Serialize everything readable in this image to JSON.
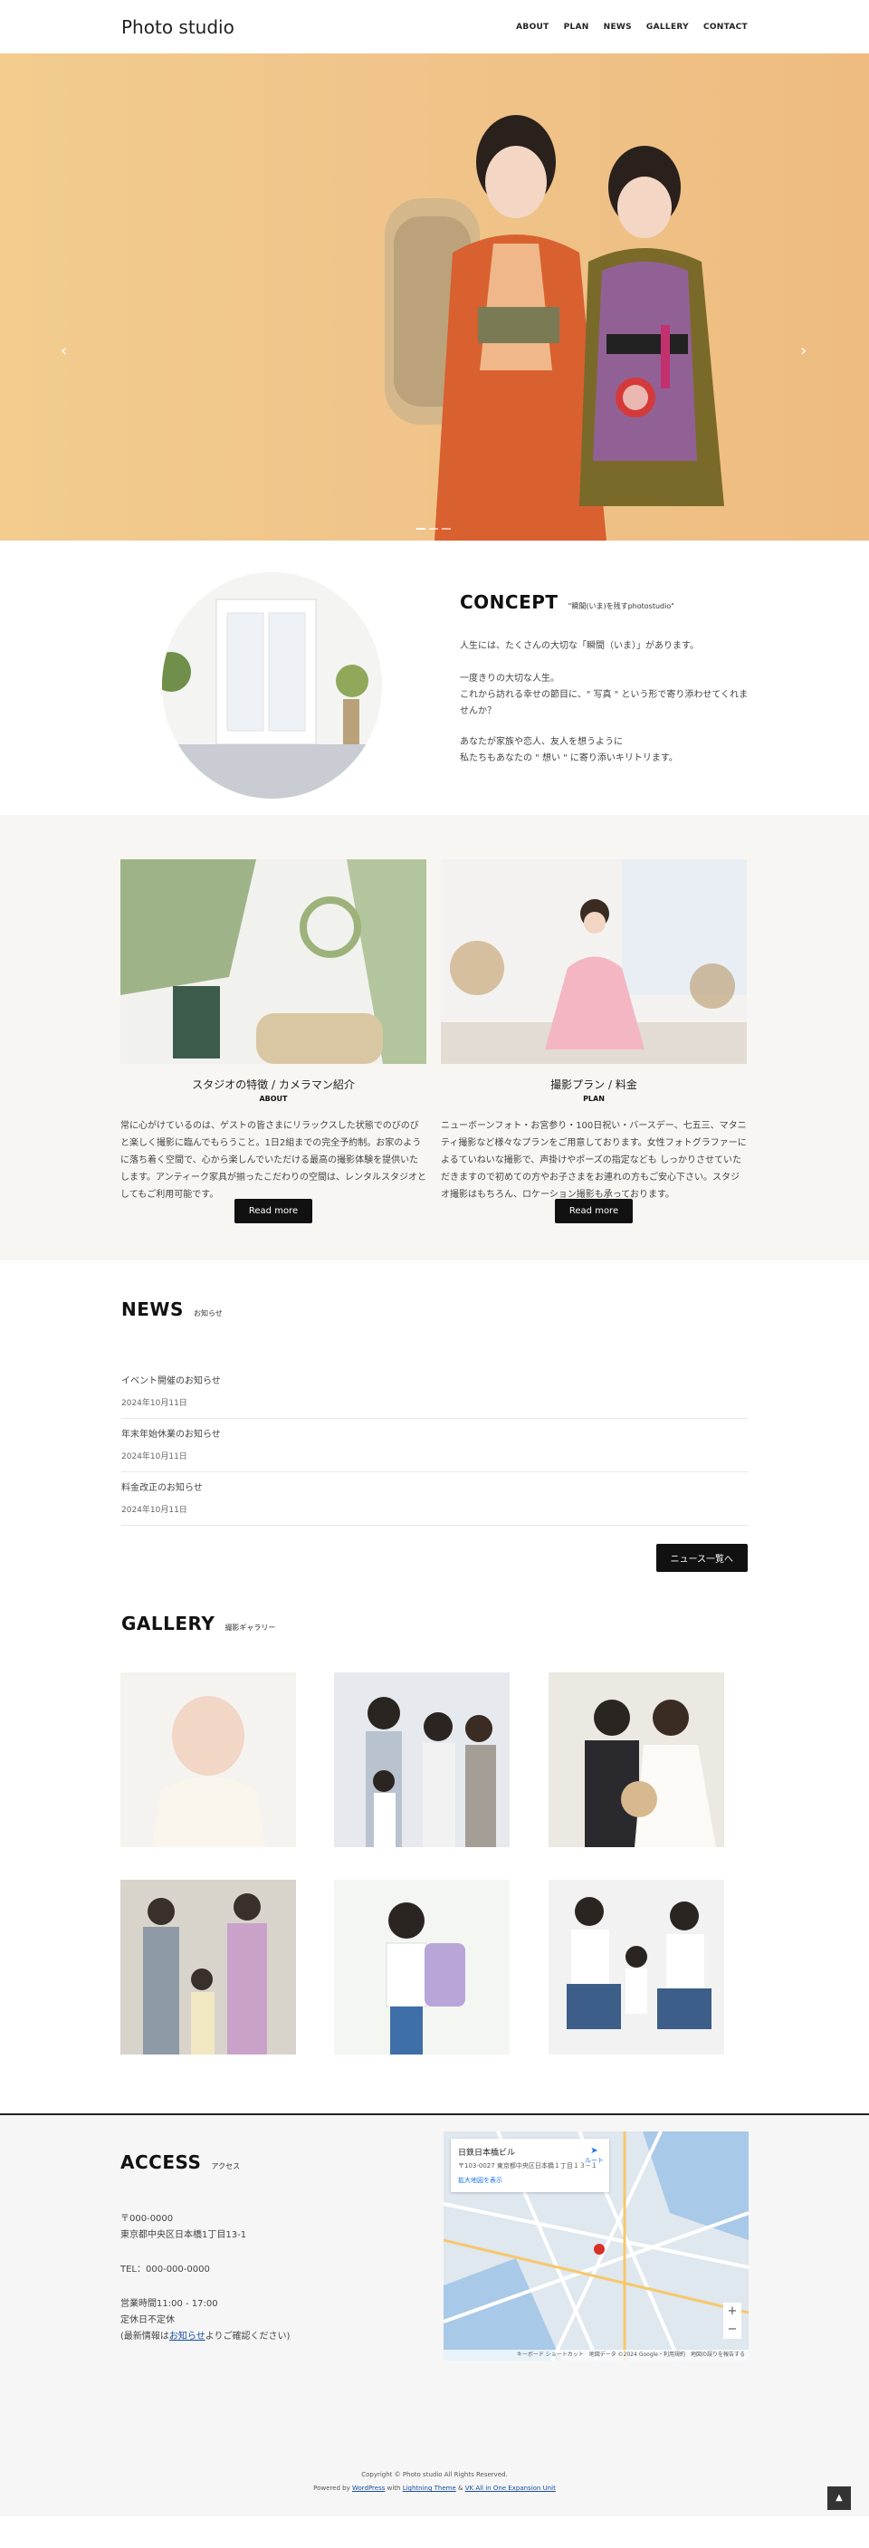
{
  "header": {
    "logo": "Photo studio",
    "nav": [
      "ABOUT",
      "PLAN",
      "NEWS",
      "GALLERY",
      "CONTACT"
    ]
  },
  "hero": {
    "prev_icon": "chevron-left-icon",
    "next_icon": "chevron-right-icon",
    "prev_glyph": "‹",
    "next_glyph": "›",
    "background_color": "#f0c58b"
  },
  "concept": {
    "title": "CONCEPT",
    "subtitle": "\"瞬間(いま)を残すphotostudio\"",
    "p1": "人生には、たくさんの大切な「瞬間（いま）」があります。",
    "p2": "一度きりの大切な人生。\nこれから訪れる幸せの節目に、\" 写真 \" という形で寄り添わせてくれませんか？",
    "p3": "あなたが家族や恋人、友人を想うように\n私たちもあなたの \" 想い \" に寄り添いキリトリます。"
  },
  "features": [
    {
      "title": "スタジオの特徴 / カメラマン紹介",
      "en": "ABOUT",
      "text": "常に心がけているのは、ゲストの皆さまにリラックスした状態でのびのびと楽しく撮影に臨んでもらうこと。1日2組までの完全予約制。お家のように落ち着く空間で、心から楽しんでいただける最高の撮影体験を提供いたします。アンティーク家具が揃ったこだわりの空間は、レンタルスタジオとしてもご利用可能です。",
      "button": "Read more"
    },
    {
      "title": "撮影プラン / 料金",
      "en": "PLAN",
      "text": "ニューボーンフォト・お宮参り・100日祝い・バースデー、七五三、マタニティ撮影など様々なプランをご用意しております。女性フォトグラファーによるていねいな撮影で、声掛けやポーズの指定なども しっかりさせていただきますので初めての方やお子さまをお連れの方もご安心下さい。スタジオ撮影はもちろん、ロケーション撮影も承っております。",
      "button": "Read more"
    }
  ],
  "news": {
    "title": "NEWS",
    "subtitle": "お知らせ",
    "items": [
      {
        "title": "イベント開催のお知らせ",
        "date": "2024年10月11日"
      },
      {
        "title": "年末年始休業のお知らせ",
        "date": "2024年10月11日"
      },
      {
        "title": "料金改正のお知らせ",
        "date": "2024年10月11日"
      }
    ],
    "more_button": "ニュース一覧へ"
  },
  "gallery": {
    "title": "GALLERY",
    "subtitle": "撮影ギャラリー"
  },
  "access": {
    "title": "ACCESS",
    "subtitle": "アクセス",
    "postal": "〒000-0000",
    "address": "東京都中央区日本橋1丁目13-1",
    "tel": "TEL：000-000-0000",
    "hours": "営業時間11:00 - 17:00",
    "closed": "定休日不定休",
    "latest_prefix": "(最新情報は",
    "latest_link": "お知らせ",
    "latest_suffix": "よりご確認ください)",
    "map": {
      "name": "日鉄日本橋ビル",
      "address": "〒103-0027 東京都中央区日本橋１丁目１３−１",
      "enlarge": "拡大地図を表示",
      "route": "ルート",
      "zoom_in": "+",
      "zoom_out": "−",
      "footer": "キーボード ショートカット　地図データ ©2024 Google・利用規約　地図の誤りを報告する"
    }
  },
  "footer": {
    "copyright": "Copyright © Photo studio All Rights Reserved.",
    "powered_prefix": "Powered by ",
    "wordpress": "WordPress",
    "with": " with ",
    "theme": "Lightning Theme",
    "amp": " & ",
    "plugin": "VK All in One Expansion Unit",
    "page_top": "▲"
  }
}
